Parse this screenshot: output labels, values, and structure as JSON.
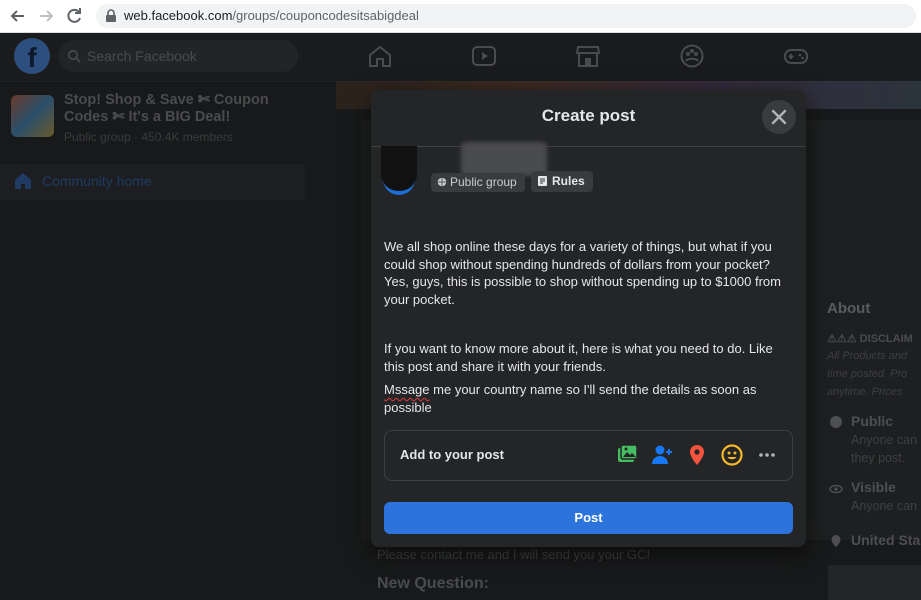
{
  "browser": {
    "url_host": "web.facebook.com",
    "url_path": "/groups/couponcodesitsabigdeal"
  },
  "fb_header": {
    "logo": "f",
    "search_placeholder": "Search Facebook"
  },
  "sidebar": {
    "group_name": "Stop! Shop & Save ✄ Coupon Codes ✄ It's a BIG Deal!",
    "group_meta": "Public group · 450.4K members",
    "community_home": "Community home"
  },
  "background": {
    "about_title": "About",
    "disclaimer": "⚠⚠⚠ DISCLAIM",
    "about_lines": [
      "All Products and",
      "time posted. Pro",
      "anytime. Prices"
    ],
    "public_title": "Public",
    "public_sub": [
      "Anyone can",
      "they post."
    ],
    "visible_title": "Visible",
    "visible_sub": "Anyone can",
    "location": "United Sta",
    "contact_text": "Please contact me and I will send you your GC!",
    "new_question": "New Question:"
  },
  "modal": {
    "title": "Create post",
    "chip_public": "Public group",
    "chip_rules": "Rules",
    "paragraphs": [
      "We all shop online these days for a variety of things, but what if you could shop without spending hundreds of dollars from your pocket? Yes, guys, this is possible to shop without spending up to $1000 from your pocket.",
      "If you want to know more about it, here is what you need to do. Like this post and share it with your friends."
    ],
    "last_word_misspelled": "Mssage",
    "last_rest": " me your country name so I'll send the details as soon as possible",
    "add_to_post": "Add to your post",
    "post_button": "Post"
  },
  "colors": {
    "accent": "#2d73dc",
    "modal_bg": "#242526",
    "page_bg": "#18191a"
  }
}
